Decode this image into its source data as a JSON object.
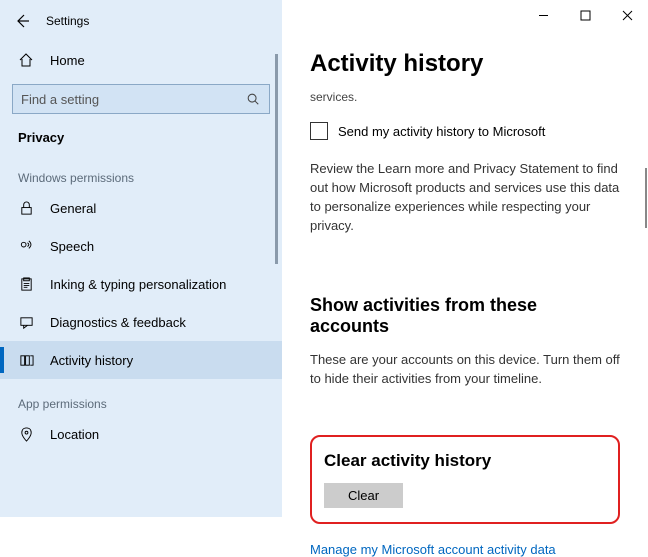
{
  "titlebar": {
    "title": "Settings"
  },
  "home": {
    "label": "Home"
  },
  "search": {
    "placeholder": "Find a setting"
  },
  "breadcrumb": "Privacy",
  "section1": "Windows permissions",
  "nav": {
    "general": "General",
    "speech": "Speech",
    "inking": "Inking & typing personalization",
    "diagnostics": "Diagnostics & feedback",
    "activity": "Activity history"
  },
  "section2": "App permissions",
  "nav2": {
    "location": "Location"
  },
  "page": {
    "heading": "Activity history",
    "partial": "services.",
    "checkbox_label": "Send my activity history to Microsoft",
    "review_para": "Review the Learn more and Privacy Statement to find out how Microsoft products and services use this data to personalize experiences while respecting your privacy.",
    "accounts_head": "Show activities from these accounts",
    "accounts_para": "These are your accounts on this device. Turn them off to hide their activities from your timeline.",
    "clear_head": "Clear activity history",
    "clear_btn": "Clear",
    "manage_link": "Manage my Microsoft account activity data"
  }
}
